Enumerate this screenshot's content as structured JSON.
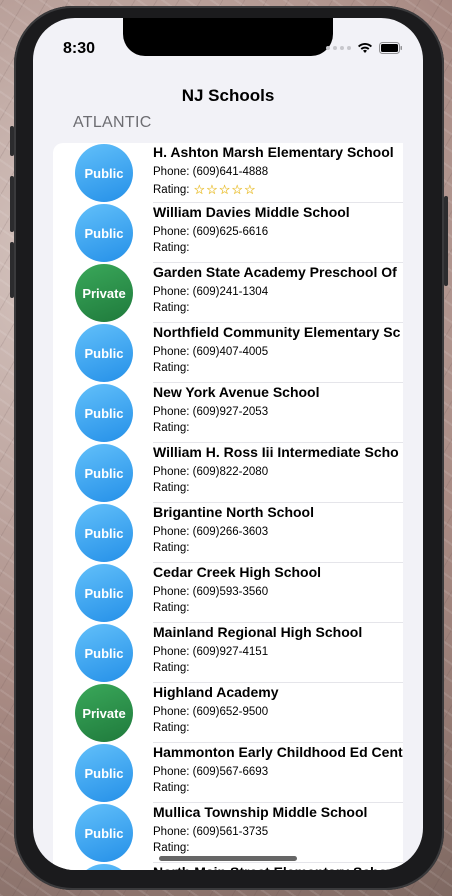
{
  "status_bar": {
    "time": "8:30"
  },
  "nav": {
    "title": "NJ Schools"
  },
  "section": {
    "header": "ATLANTIC"
  },
  "rating_label": "Rating:",
  "schools": [
    {
      "name": "H. Ashton Marsh Elementary School",
      "type": "Public",
      "phone": "Phone: (609)641-4888",
      "stars": "☆☆☆☆☆"
    },
    {
      "name": "William Davies Middle School",
      "type": "Public",
      "phone": "Phone: (609)625-6616",
      "stars": ""
    },
    {
      "name": "Garden State Academy Preschool Of",
      "type": "Private",
      "phone": "Phone: (609)241-1304",
      "stars": ""
    },
    {
      "name": "Northfield Community Elementary Sc",
      "type": "Public",
      "phone": "Phone: (609)407-4005",
      "stars": ""
    },
    {
      "name": "New York Avenue School",
      "type": "Public",
      "phone": "Phone: (609)927-2053",
      "stars": ""
    },
    {
      "name": "William H. Ross Iii Intermediate Scho",
      "type": "Public",
      "phone": "Phone: (609)822-2080",
      "stars": ""
    },
    {
      "name": "Brigantine North School",
      "type": "Public",
      "phone": "Phone: (609)266-3603",
      "stars": ""
    },
    {
      "name": "Cedar Creek High School",
      "type": "Public",
      "phone": "Phone: (609)593-3560",
      "stars": ""
    },
    {
      "name": "Mainland Regional High School",
      "type": "Public",
      "phone": "Phone: (609)927-4151",
      "stars": ""
    },
    {
      "name": "Highland Academy",
      "type": "Private",
      "phone": "Phone: (609)652-9500",
      "stars": ""
    },
    {
      "name": "Hammonton Early Childhood Ed Cent",
      "type": "Public",
      "phone": "Phone: (609)567-6693",
      "stars": ""
    },
    {
      "name": "Mullica Township Middle School",
      "type": "Public",
      "phone": "Phone: (609)561-3735",
      "stars": ""
    },
    {
      "name": "North Main Street Elementary Scho",
      "type": "Public",
      "phone": "",
      "stars": ""
    }
  ],
  "colors": {
    "public_badge": "#3aa8f5",
    "private_badge": "#2e9150",
    "star": "#f5c518"
  }
}
